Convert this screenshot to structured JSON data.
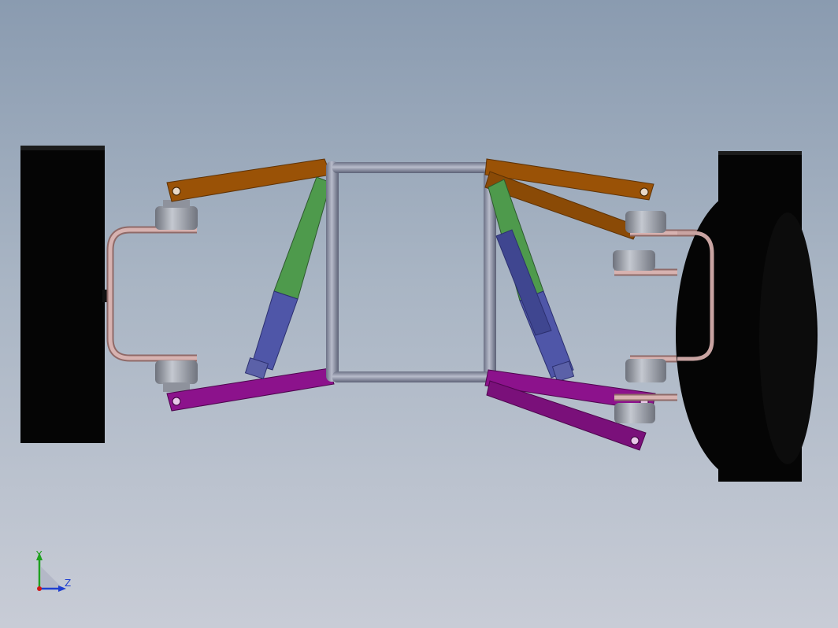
{
  "viewport": {
    "background_top": "#8a9bb0",
    "background_bottom": "#c8ccd6"
  },
  "triad": {
    "y_label": "Y",
    "z_label": "Z",
    "y_color": "#1fa01f",
    "z_color": "#1f3fd0",
    "icon": "coordinate-triad-icon"
  },
  "model": {
    "parts": [
      {
        "name": "left-wheel",
        "color": "#050505"
      },
      {
        "name": "right-wheel",
        "color": "#050505"
      },
      {
        "name": "upper-control-arms",
        "color": "#9a5206"
      },
      {
        "name": "lower-control-arms",
        "color": "#8c128c"
      },
      {
        "name": "shock-springs",
        "color": "#4e9a4c"
      },
      {
        "name": "shock-dampers",
        "color": "#4f56a8"
      },
      {
        "name": "uprights",
        "color": "#c8a4a2"
      },
      {
        "name": "chassis-frame",
        "color": "#858aa0"
      },
      {
        "name": "ball-joints",
        "color": "#8e929c"
      }
    ]
  }
}
